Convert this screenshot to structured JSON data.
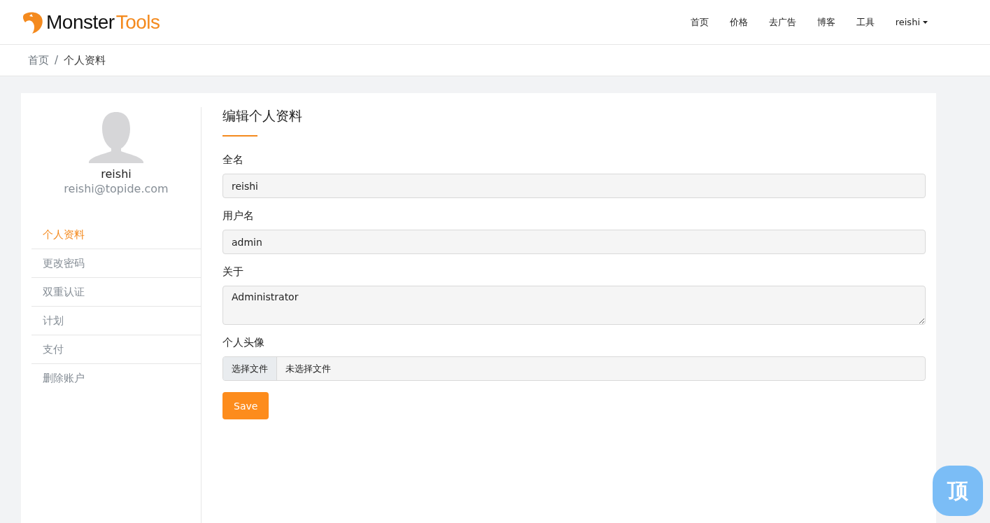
{
  "logo": {
    "part_1": "Monster",
    "part_2": "Tools"
  },
  "nav": [
    {
      "label": "首页"
    },
    {
      "label": "价格"
    },
    {
      "label": "去广告"
    },
    {
      "label": "博客"
    },
    {
      "label": "工具"
    },
    {
      "label": "reishi",
      "kind": "dropdown"
    }
  ],
  "breadcrumb": {
    "items": [
      "首页",
      "个人资料"
    ],
    "separator": "/"
  },
  "profile": {
    "name": "reishi",
    "email": "reishi@topide.com"
  },
  "sidebar": {
    "items": [
      {
        "label": "个人资料",
        "selected": true
      },
      {
        "label": "更改密码",
        "selected": false
      },
      {
        "label": "双重认证",
        "selected": false
      },
      {
        "label": "计划",
        "selected": false
      },
      {
        "label": "支付",
        "selected": false
      },
      {
        "label": "删除账户",
        "selected": false
      }
    ]
  },
  "form": {
    "title": "编辑个人资料",
    "fields": [
      {
        "kind": "text",
        "label": "全名",
        "value": "reishi"
      },
      {
        "kind": "text",
        "label": "用户名",
        "value": "admin"
      },
      {
        "kind": "textarea",
        "label": "关于",
        "value": "Administrator"
      },
      {
        "kind": "file",
        "label": "个人头像",
        "button": "选择文件",
        "value": "未选择文件"
      }
    ],
    "submit": "Save"
  },
  "back_to_top": "顶"
}
